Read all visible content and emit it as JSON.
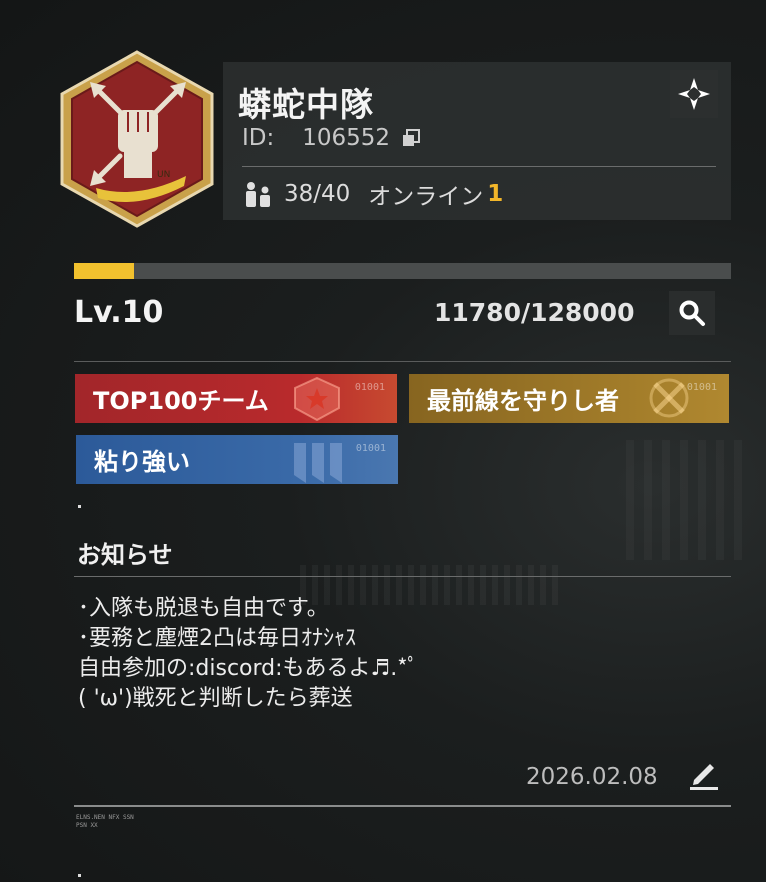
{
  "guild": {
    "name": "蟒蛇中隊",
    "id_label": "ID:",
    "id_value": "106552",
    "members": "38/40",
    "online_label": "オンライン",
    "online_count": "1",
    "emblem_text": "UN"
  },
  "level": {
    "label": "Lv.10",
    "xp": "11780/128000",
    "progress_fraction": 0.092
  },
  "tags": [
    {
      "label": "TOP100チーム",
      "code": "01001",
      "color": "#b12a2c"
    },
    {
      "label": "最前線を守りし者",
      "code": "01001",
      "color": "#9a7528"
    },
    {
      "label": "粘り強い",
      "code": "01001",
      "color": "#3565a3"
    }
  ],
  "notice": {
    "title": "お知らせ",
    "lines": [
      "･入隊も脱退も自由です。",
      "･要務と塵煙2凸は毎日ｵﾅｼｬｽ",
      "自由参加の:discord:もあるよ♬.*ﾟ",
      "( 'ω')戦死と判断したら葬送"
    ],
    "date": "2026.02.08"
  },
  "footer": {
    "tiny_line1": "ELNS.NEN NFX SSN",
    "tiny_line2": "PSN XX"
  },
  "icons": {
    "target": "target-icon",
    "copy": "copy-icon",
    "members": "members-icon",
    "search": "search-icon",
    "edit": "edit-icon"
  },
  "colors": {
    "accent_yellow": "#f2c12e",
    "online_yellow": "#f2b62a"
  }
}
